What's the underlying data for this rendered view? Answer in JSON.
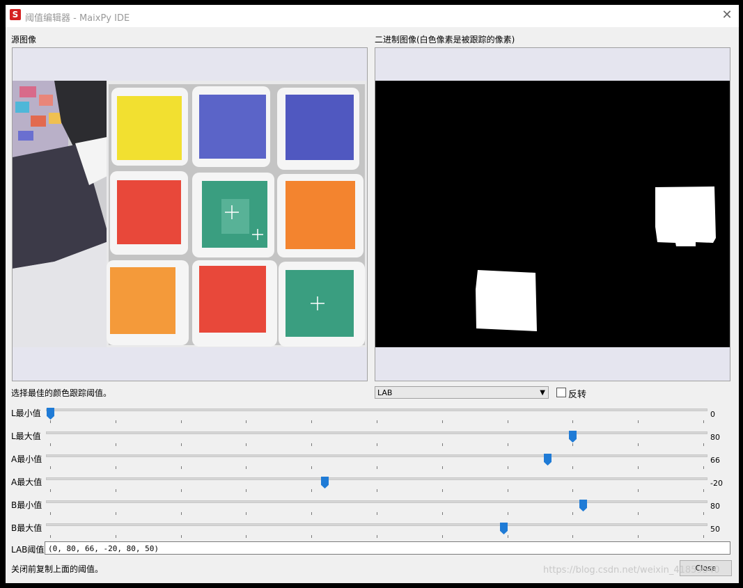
{
  "window": {
    "title": "阈值编辑器 - MaixPy IDE",
    "app_icon_glyph": "S",
    "close_glyph": "✕"
  },
  "source_panel": {
    "label": "源图像"
  },
  "binary_panel": {
    "label": "二进制图像(白色像素是被跟踪的像素)"
  },
  "controls": {
    "instruction": "选择最佳的颜色跟踪阈值。",
    "colorspace": {
      "selected": "LAB",
      "arrow": "▼"
    },
    "invert": {
      "label": "反转",
      "checked": false
    }
  },
  "sliders": [
    {
      "label": "L最小值",
      "value": "0",
      "fraction": 0.0
    },
    {
      "label": "L最大值",
      "value": "80",
      "fraction": 0.8
    },
    {
      "label": "A最小值",
      "value": "66",
      "fraction": 0.762
    },
    {
      "label": "A最大值",
      "value": "-20",
      "fraction": 0.42
    },
    {
      "label": "B最小值",
      "value": "80",
      "fraction": 0.816
    },
    {
      "label": "B最大值",
      "value": "50",
      "fraction": 0.695
    }
  ],
  "lab_threshold": {
    "label": "LAB阈值",
    "value": "(0, 80, 66, -20, 80, 50)"
  },
  "footer": {
    "hint": "关闭前复制上面的阈值。",
    "close_label": "Close",
    "watermark": "https://blog.csdn.net/weixin_41859540"
  },
  "colors": {
    "slider_handle": "#1f7bd6",
    "cube_yellow": "#f2e030",
    "cube_blue": "#5b64c8",
    "cube_red": "#e8483a",
    "cube_green": "#3a9e80",
    "cube_orange": "#f3842f"
  }
}
